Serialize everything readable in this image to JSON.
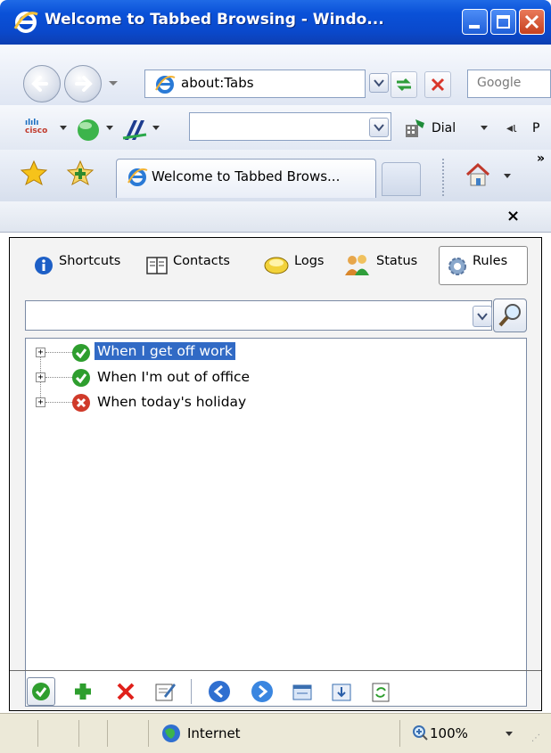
{
  "window": {
    "title": "Welcome to Tabbed Browsing - Windo..."
  },
  "navbar": {
    "address": "about:Tabs",
    "search_placeholder": "Google"
  },
  "toolbar2": {
    "dial_label": "Dial",
    "p_label": "P"
  },
  "tab": {
    "title": "Welcome to Tabbed Brows..."
  },
  "panel": {
    "close_glyph": "×",
    "tabs": [
      {
        "label": "Shortcuts"
      },
      {
        "label": "Contacts"
      },
      {
        "label": "Logs"
      },
      {
        "label": "Status"
      },
      {
        "label": "Rules"
      }
    ],
    "search_value": "",
    "rules": [
      {
        "label": "When I get off work",
        "status": "enabled",
        "selected": true
      },
      {
        "label": "When I'm out of office",
        "status": "enabled",
        "selected": false
      },
      {
        "label": "When today's holiday",
        "status": "disabled",
        "selected": false
      }
    ]
  },
  "statusbar": {
    "zone": "Internet",
    "zoom": "100%"
  },
  "colors": {
    "titlebar": "#0a51d8",
    "selection": "#316ac5",
    "enabled": "#2e9e2e",
    "disabled": "#d03a2a"
  }
}
